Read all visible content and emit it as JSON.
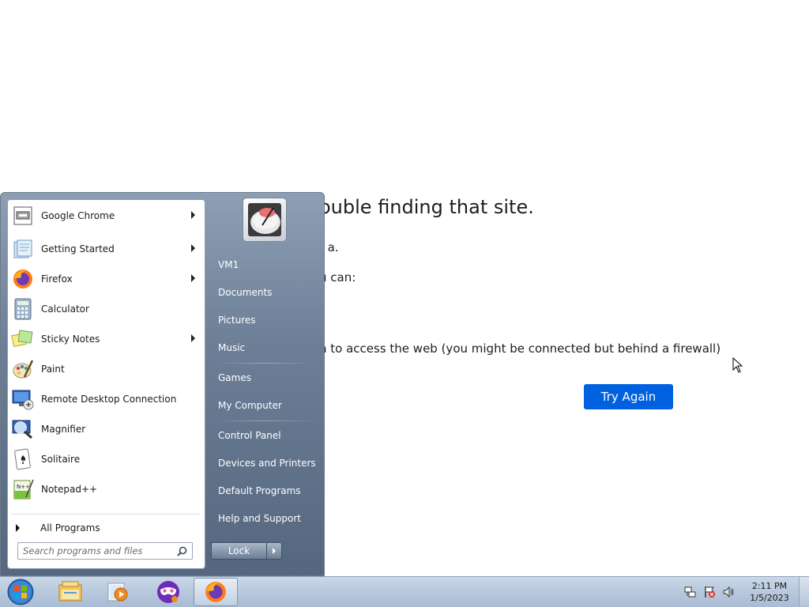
{
  "browser_page": {
    "title": "ouble finding that site.",
    "line1": "t a.",
    "line2": "u can:",
    "line3": "n to access the web (you might be connected but behind a firewall)",
    "try_again": "Try Again"
  },
  "start_menu": {
    "programs": [
      {
        "label": "Google Chrome",
        "icon": "chrome-icon",
        "has_arrow": true
      },
      {
        "label": "Getting Started",
        "icon": "getting-started-icon",
        "has_arrow": true
      },
      {
        "label": "Firefox",
        "icon": "firefox-icon",
        "has_arrow": true
      },
      {
        "label": "Calculator",
        "icon": "calculator-icon",
        "has_arrow": false
      },
      {
        "label": "Sticky Notes",
        "icon": "sticky-notes-icon",
        "has_arrow": true
      },
      {
        "label": "Paint",
        "icon": "paint-icon",
        "has_arrow": false
      },
      {
        "label": "Remote Desktop Connection",
        "icon": "remote-desktop-icon",
        "has_arrow": false
      },
      {
        "label": "Magnifier",
        "icon": "magnifier-icon",
        "has_arrow": false
      },
      {
        "label": "Solitaire",
        "icon": "solitaire-icon",
        "has_arrow": false
      },
      {
        "label": "Notepad++",
        "icon": "notepad-plus-plus-icon",
        "has_arrow": false
      }
    ],
    "all_programs": "All Programs",
    "search_placeholder": "Search programs and files",
    "places": [
      "VM1",
      "Documents",
      "Pictures",
      "Music",
      "Games",
      "My Computer",
      "Control Panel",
      "Devices and Printers",
      "Default Programs",
      "Help and Support"
    ],
    "lock_label": "Lock"
  },
  "taskbar": {
    "pinned": [
      "windows-explorer-icon",
      "media-player-icon",
      "masked-app-icon",
      "firefox-icon"
    ],
    "clock_time": "2:11 PM",
    "clock_date": "1/5/2023"
  }
}
